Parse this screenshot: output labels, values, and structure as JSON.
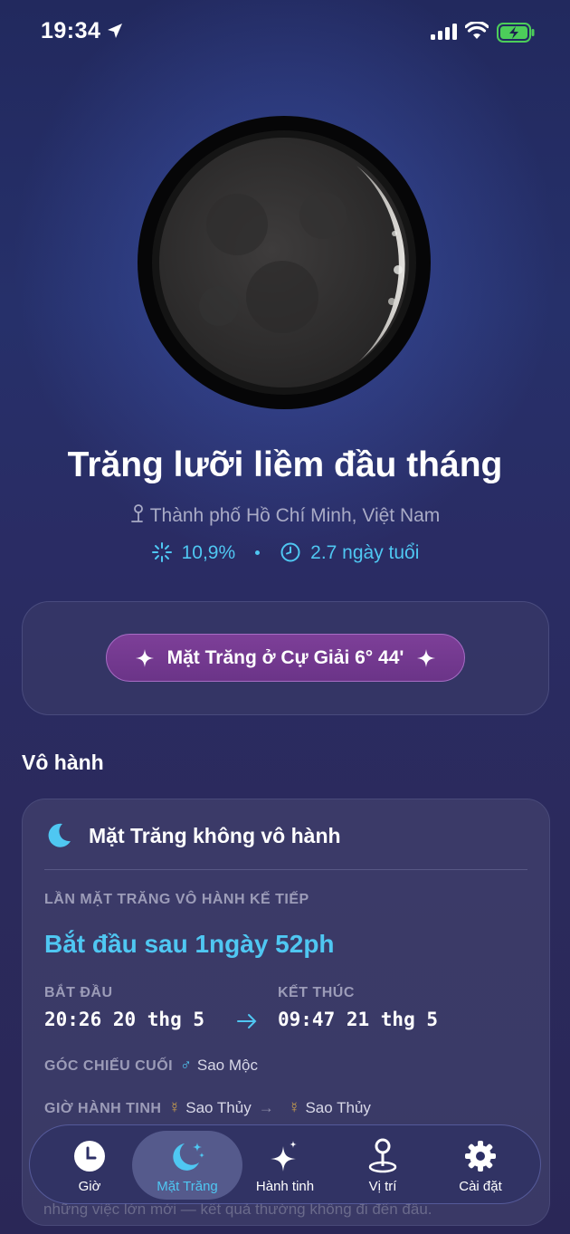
{
  "status_bar": {
    "time": "19:34"
  },
  "moon": {
    "phase_name": "Trăng lưỡi liềm đầu tháng",
    "location": "Thành phố Hồ Chí Minh, Việt Nam",
    "illumination": "10,9%",
    "age": "2.7 ngày tuổi"
  },
  "sign": {
    "label": "Mặt Trăng ở Cự Giải 6° 44'"
  },
  "void_section": {
    "title": "Vô hành",
    "status": "Mặt Trăng không vô hành",
    "next_label": "LẦN MẶT TRĂNG VÔ HÀNH KẾ TIẾP",
    "countdown": "Bắt đầu sau 1ngày 52ph",
    "start_label": "BẮT ĐẦU",
    "start_value": "20:26 20 thg 5",
    "end_label": "KẾT THÚC",
    "end_value": "09:47 21 thg 5",
    "last_aspect_label": "GÓC CHIẾU CUỐI",
    "last_aspect_symbol": "♂",
    "last_aspect_value": "Sao Mộc",
    "planet_hour_label": "GIỜ HÀNH TINH",
    "planet_hour_symbol": "☿",
    "planet_hour_from": "Sao Thủy",
    "planet_hour_to": "Sao Thủy",
    "footer_text": "những việc lớn mới — kết quả thường không đi đến đâu."
  },
  "tabs": [
    {
      "label": "Giờ",
      "icon": "clock-icon"
    },
    {
      "label": "Mặt Trăng",
      "icon": "moon-stars-icon"
    },
    {
      "label": "Hành tinh",
      "icon": "sparkles-icon"
    },
    {
      "label": "Vị trí",
      "icon": "map-pin-icon"
    },
    {
      "label": "Cài đặt",
      "icon": "gear-icon"
    }
  ],
  "active_tab": "Mặt Trăng",
  "colors": {
    "accent": "#4fc7f2",
    "pill": "#7d3f98",
    "background": "#26306a"
  }
}
